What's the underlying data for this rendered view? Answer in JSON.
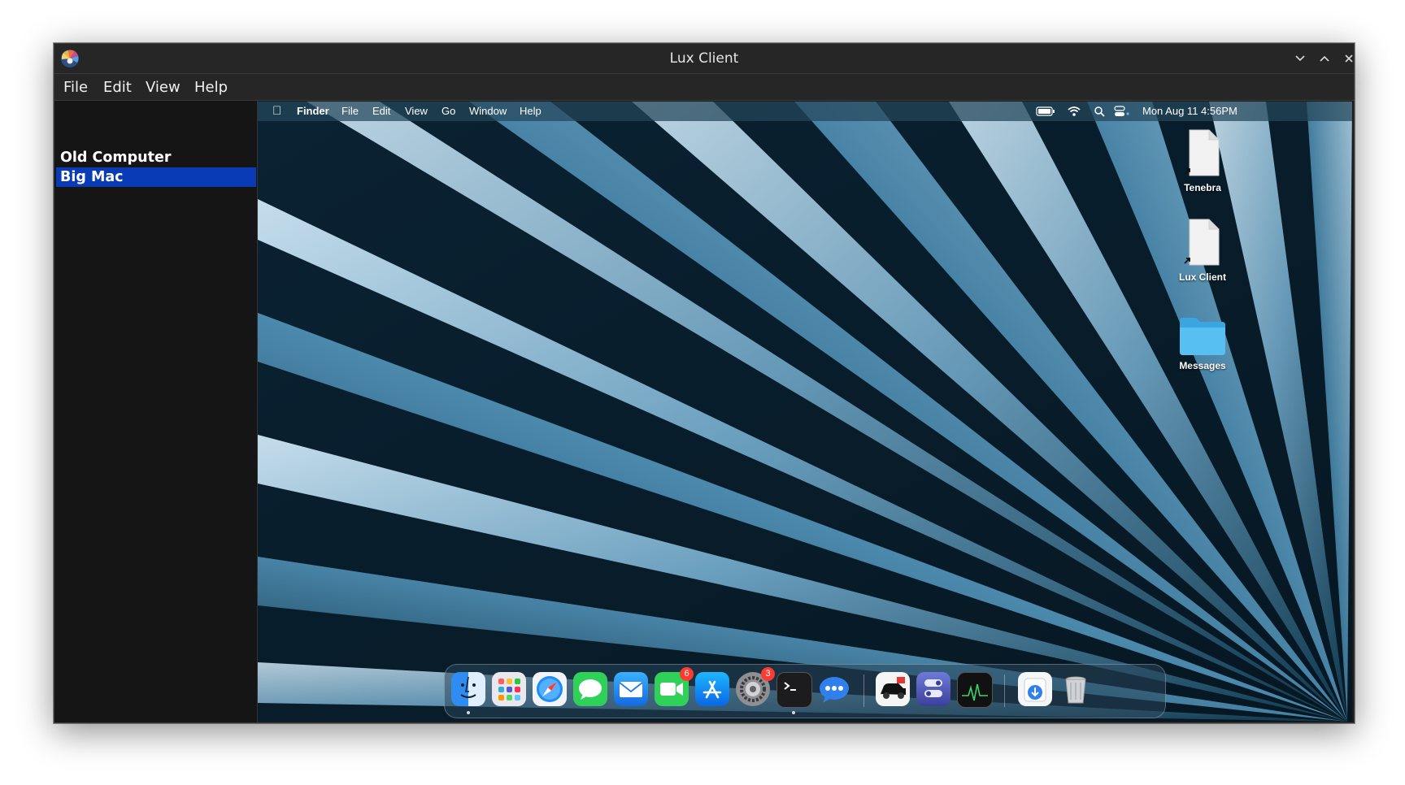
{
  "window": {
    "title": "Lux Client"
  },
  "menu": [
    "File",
    "Edit",
    "View",
    "Help"
  ],
  "sidebar": {
    "items": [
      {
        "label": "Old Computer",
        "selected": false
      },
      {
        "label": "Big Mac",
        "selected": true
      }
    ]
  },
  "mac": {
    "menubar": {
      "app": "Finder",
      "items": [
        "File",
        "Edit",
        "View",
        "Go",
        "Window",
        "Help"
      ],
      "clock": "Mon Aug 11  4:56PM"
    },
    "desktop_icons": [
      "Tenebra",
      "Lux Client",
      "Messages"
    ],
    "dock": {
      "apps": [
        {
          "icon": "finder-icon",
          "running": true
        },
        {
          "icon": "launchpad-icon"
        },
        {
          "icon": "safari-icon"
        },
        {
          "icon": "messages-icon"
        },
        {
          "icon": "mail-icon"
        },
        {
          "icon": "facetime-icon",
          "badge": "6"
        },
        {
          "icon": "app-store-icon"
        },
        {
          "icon": "system-settings-icon",
          "badge": "3"
        },
        {
          "icon": "terminal-icon",
          "running": true
        },
        {
          "icon": "chat-bubble-icon"
        }
      ],
      "extra_apps": [
        {
          "icon": "car-app-icon"
        },
        {
          "icon": "server-app-icon"
        },
        {
          "icon": "activity-monitor-icon"
        }
      ],
      "right_items": [
        {
          "icon": "downloads-folder-icon"
        },
        {
          "icon": "trash-icon"
        }
      ]
    }
  },
  "colors": {
    "accent_selection": "#0a3bb6",
    "window_bg": "#1b1b1b"
  }
}
